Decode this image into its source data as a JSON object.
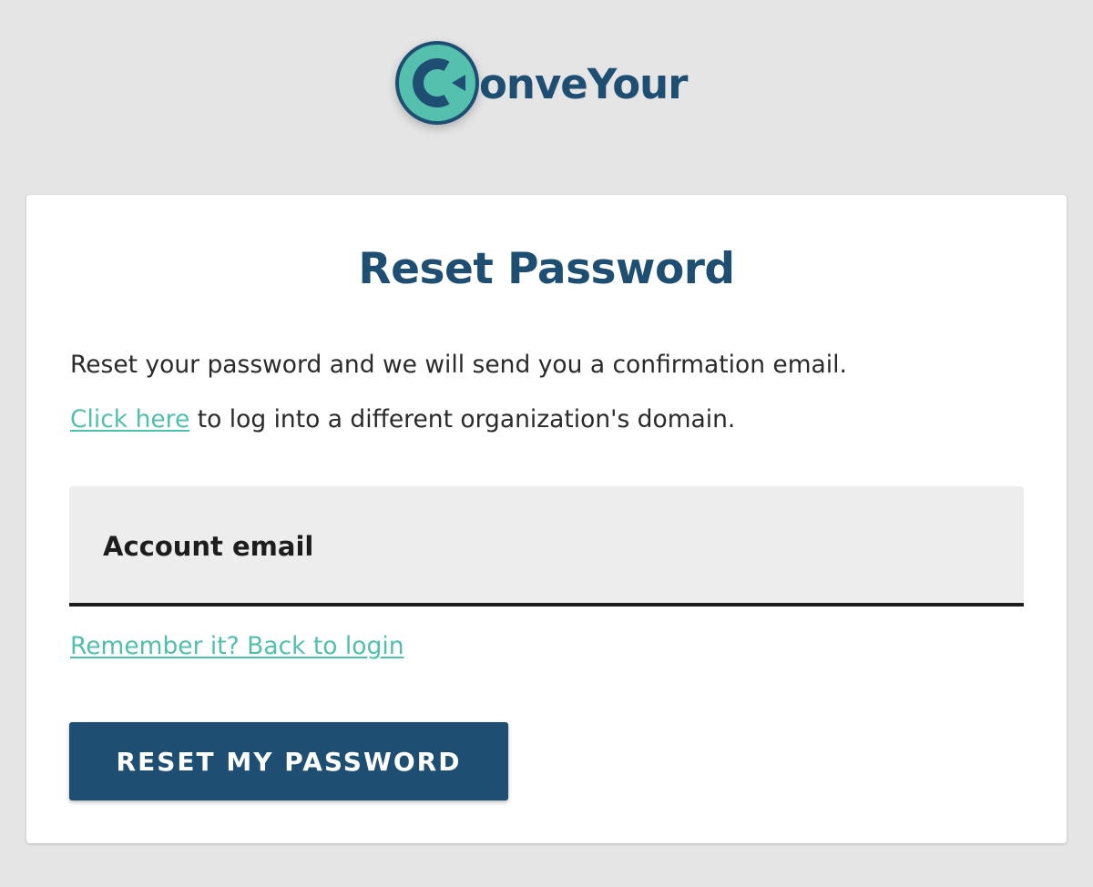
{
  "brand": {
    "name": "ConveYour",
    "wordmark_tail": "onveYour",
    "logo_icon": "conveyour-c-arrow-icon",
    "colors": {
      "navy": "#1f4e73",
      "teal": "#52bfad"
    }
  },
  "card": {
    "title": "Reset Password",
    "description": "Reset your password and we will send you a confirmation email.",
    "org_link_label": "Click here",
    "org_link_suffix": " to log into a different organization's domain.",
    "email_field": {
      "label": "Account email",
      "value": ""
    },
    "back_link_label": "Remember it? Back to login",
    "submit_label": "RESET MY PASSWORD"
  },
  "colors": {
    "page_background": "#e5e5e6",
    "card_background": "#ffffff",
    "field_background": "#ededed",
    "link": "#52bfad",
    "button": "#1f4e73",
    "text": "#2a2a2a"
  }
}
